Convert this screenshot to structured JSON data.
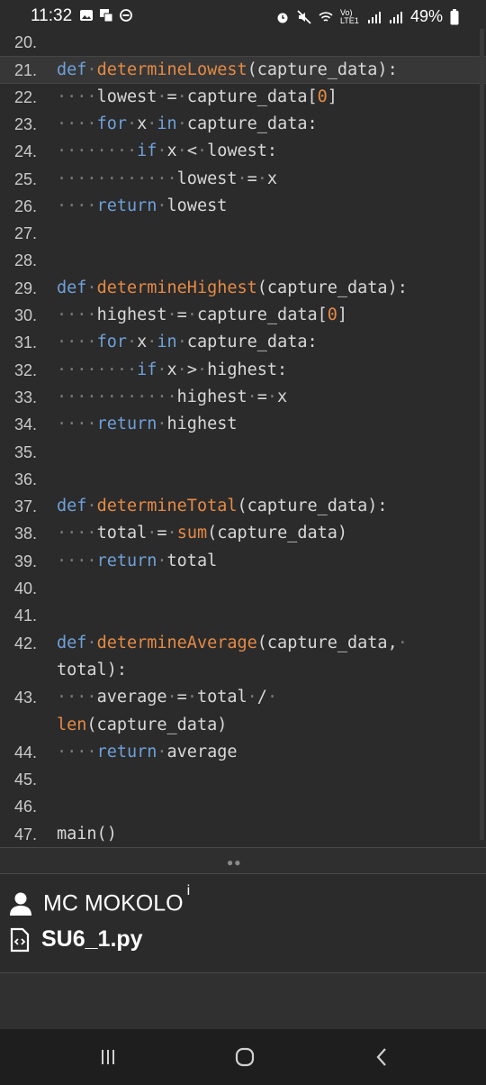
{
  "status_bar": {
    "time": "11:32",
    "battery": "49%",
    "network": "Vo) LTE1",
    "icons": [
      "gallery-icon",
      "notification-icon",
      "dnd-icon",
      "alarm-icon",
      "mute-icon",
      "wifi-icon",
      "signal-icon",
      "signal-icon",
      "battery-icon"
    ]
  },
  "editor": {
    "current_line": "21.",
    "lines": [
      {
        "n": "20.",
        "tokens": []
      },
      {
        "n": "21.",
        "tokens": [
          [
            "kw",
            "def"
          ],
          [
            "dot",
            "·"
          ],
          [
            "fn",
            "determineLowest"
          ],
          [
            "t",
            "(capture_data):"
          ]
        ]
      },
      {
        "n": "22.",
        "tokens": [
          [
            "dot",
            "····"
          ],
          [
            "t",
            "lowest"
          ],
          [
            "dot",
            "·"
          ],
          [
            "t",
            "="
          ],
          [
            "dot",
            "·"
          ],
          [
            "t",
            "capture_data["
          ],
          [
            "num",
            "0"
          ],
          [
            "t",
            "]"
          ]
        ]
      },
      {
        "n": "23.",
        "tokens": [
          [
            "dot",
            "····"
          ],
          [
            "kw",
            "for"
          ],
          [
            "dot",
            "·"
          ],
          [
            "t",
            "x"
          ],
          [
            "dot",
            "·"
          ],
          [
            "kw",
            "in"
          ],
          [
            "dot",
            "·"
          ],
          [
            "t",
            "capture_data:"
          ]
        ]
      },
      {
        "n": "24.",
        "tokens": [
          [
            "dot",
            "········"
          ],
          [
            "kw",
            "if"
          ],
          [
            "dot",
            "·"
          ],
          [
            "t",
            "x"
          ],
          [
            "dot",
            "·"
          ],
          [
            "t",
            "<"
          ],
          [
            "dot",
            "·"
          ],
          [
            "t",
            "lowest:"
          ]
        ]
      },
      {
        "n": "25.",
        "tokens": [
          [
            "dot",
            "············"
          ],
          [
            "t",
            "lowest"
          ],
          [
            "dot",
            "·"
          ],
          [
            "t",
            "="
          ],
          [
            "dot",
            "·"
          ],
          [
            "t",
            "x"
          ]
        ]
      },
      {
        "n": "26.",
        "tokens": [
          [
            "dot",
            "····"
          ],
          [
            "kw",
            "return"
          ],
          [
            "dot",
            "·"
          ],
          [
            "t",
            "lowest"
          ]
        ]
      },
      {
        "n": "27.",
        "tokens": []
      },
      {
        "n": "28.",
        "tokens": []
      },
      {
        "n": "29.",
        "tokens": [
          [
            "kw",
            "def"
          ],
          [
            "dot",
            "·"
          ],
          [
            "fn",
            "determineHighest"
          ],
          [
            "t",
            "(capture_data):"
          ]
        ]
      },
      {
        "n": "30.",
        "tokens": [
          [
            "dot",
            "····"
          ],
          [
            "t",
            "highest"
          ],
          [
            "dot",
            "·"
          ],
          [
            "t",
            "="
          ],
          [
            "dot",
            "·"
          ],
          [
            "t",
            "capture_data["
          ],
          [
            "num",
            "0"
          ],
          [
            "t",
            "]"
          ]
        ]
      },
      {
        "n": "31.",
        "tokens": [
          [
            "dot",
            "····"
          ],
          [
            "kw",
            "for"
          ],
          [
            "dot",
            "·"
          ],
          [
            "t",
            "x"
          ],
          [
            "dot",
            "·"
          ],
          [
            "kw",
            "in"
          ],
          [
            "dot",
            "·"
          ],
          [
            "t",
            "capture_data:"
          ]
        ]
      },
      {
        "n": "32.",
        "tokens": [
          [
            "dot",
            "········"
          ],
          [
            "kw",
            "if"
          ],
          [
            "dot",
            "·"
          ],
          [
            "t",
            "x"
          ],
          [
            "dot",
            "·"
          ],
          [
            "t",
            ">"
          ],
          [
            "dot",
            "·"
          ],
          [
            "t",
            "highest:"
          ]
        ]
      },
      {
        "n": "33.",
        "tokens": [
          [
            "dot",
            "············"
          ],
          [
            "t",
            "highest"
          ],
          [
            "dot",
            "·"
          ],
          [
            "t",
            "="
          ],
          [
            "dot",
            "·"
          ],
          [
            "t",
            "x"
          ]
        ]
      },
      {
        "n": "34.",
        "tokens": [
          [
            "dot",
            "····"
          ],
          [
            "kw",
            "return"
          ],
          [
            "dot",
            "·"
          ],
          [
            "t",
            "highest"
          ]
        ]
      },
      {
        "n": "35.",
        "tokens": []
      },
      {
        "n": "36.",
        "tokens": []
      },
      {
        "n": "37.",
        "tokens": [
          [
            "kw",
            "def"
          ],
          [
            "dot",
            "·"
          ],
          [
            "fn",
            "determineTotal"
          ],
          [
            "t",
            "(capture_data):"
          ]
        ]
      },
      {
        "n": "38.",
        "tokens": [
          [
            "dot",
            "····"
          ],
          [
            "t",
            "total"
          ],
          [
            "dot",
            "·"
          ],
          [
            "t",
            "="
          ],
          [
            "dot",
            "·"
          ],
          [
            "fn",
            "sum"
          ],
          [
            "t",
            "(capture_data)"
          ]
        ]
      },
      {
        "n": "39.",
        "tokens": [
          [
            "dot",
            "····"
          ],
          [
            "kw",
            "return"
          ],
          [
            "dot",
            "·"
          ],
          [
            "t",
            "total"
          ]
        ]
      },
      {
        "n": "40.",
        "tokens": []
      },
      {
        "n": "41.",
        "tokens": []
      },
      {
        "n": "42.",
        "tokens": [
          [
            "kw",
            "def"
          ],
          [
            "dot",
            "·"
          ],
          [
            "fn",
            "determineAverage"
          ],
          [
            "t",
            "(capture_data,"
          ],
          [
            "dot",
            "·"
          ]
        ]
      },
      {
        "n": "",
        "tokens": [
          [
            "t",
            "total):"
          ]
        ]
      },
      {
        "n": "43.",
        "tokens": [
          [
            "dot",
            "····"
          ],
          [
            "t",
            "average"
          ],
          [
            "dot",
            "·"
          ],
          [
            "t",
            "="
          ],
          [
            "dot",
            "·"
          ],
          [
            "t",
            "total"
          ],
          [
            "dot",
            "·"
          ],
          [
            "t",
            "/"
          ],
          [
            "dot",
            "·"
          ]
        ]
      },
      {
        "n": "",
        "tokens": [
          [
            "fn",
            "len"
          ],
          [
            "t",
            "(capture_data)"
          ]
        ]
      },
      {
        "n": "44.",
        "tokens": [
          [
            "dot",
            "····"
          ],
          [
            "kw",
            "return"
          ],
          [
            "dot",
            "·"
          ],
          [
            "t",
            "average"
          ]
        ]
      },
      {
        "n": "45.",
        "tokens": []
      },
      {
        "n": "46.",
        "tokens": []
      },
      {
        "n": "47.",
        "tokens": [
          [
            "t",
            "main()"
          ]
        ]
      }
    ]
  },
  "info": {
    "author": "MC MOKOLO",
    "author_info": "i",
    "filename": "SU6_1.py"
  },
  "colors": {
    "background": "#2b2b2b",
    "keyword": "#6fa0d8",
    "function": "#e58a45",
    "text": "#d8d8d8"
  }
}
